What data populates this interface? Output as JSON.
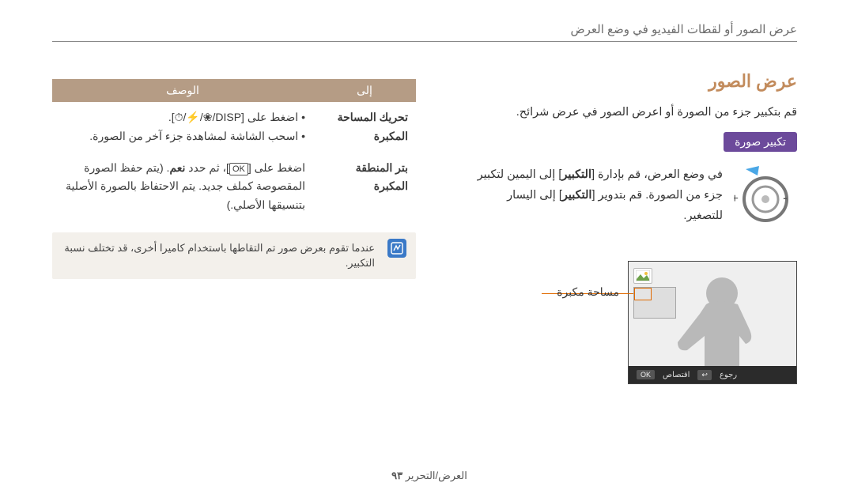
{
  "header": {
    "breadcrumb": "عرض الصور أو لقطات الفيديو في وضع العرض"
  },
  "right": {
    "title": "عرض الصور",
    "intro": "قم بتكبير جزء من الصورة أو اعرض الصور في عرض شرائح.",
    "subhead": "تكبير صورة",
    "dial_text_1": "في وضع العرض، قم بإدارة [",
    "dial_kw_1": "التكبير",
    "dial_text_2": "] إلى اليمين لتكبير جزء من الصورة. قم بتدوير [",
    "dial_kw_2": "التكبير",
    "dial_text_3": "] إلى اليسار للتصغير."
  },
  "table": {
    "head_to": "إلى",
    "head_desc": "الوصف",
    "r1_label": "تحريك المساحة المكبرة",
    "r1_b1": "اضغط على [DISP/",
    "r1_b1_tail": "].",
    "r1_b2": "اسحب الشاشة لمشاهدة جزء آخر من الصورة.",
    "r2_label": "بتر المنطقة المكبرة",
    "r2_desc_pre": "اضغط على ",
    "r2_ok": "OK",
    "r2_desc_mid": "، ثم حدد ",
    "r2_yes": "نعم",
    "r2_desc_post": ". (يتم حفظ الصورة المقصوصة كملف جديد. يتم الاحتفاظ بالصورة الأصلية بتنسيقها الأصلي.)"
  },
  "note": {
    "text": "عندما تقوم بعرض صور تم التقاطها باستخدام كاميرا أخرى، قد تختلف نسبة التكبير."
  },
  "preview": {
    "callout": "مساحة مكبرة",
    "status_crop": "اقتصاص",
    "status_back": "رجوع",
    "btn_ok": "OK",
    "btn_back": "↩"
  },
  "icons": {
    "flower": "❀",
    "bolt": "⚡",
    "timer": "⏱"
  },
  "footer": {
    "section": "العرض/التحرير",
    "page": "٩٣"
  }
}
